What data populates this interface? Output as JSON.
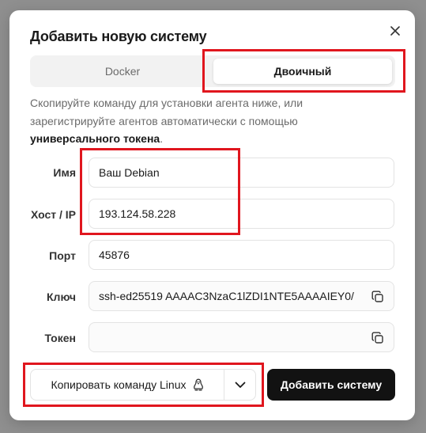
{
  "dialog": {
    "title": "Добавить новую систему",
    "close_icon": "close-icon"
  },
  "tabs": [
    {
      "label": "Docker",
      "active": false
    },
    {
      "label": "Двоичный",
      "active": true
    }
  ],
  "description": {
    "text": "Скопируйте команду для установки агента ниже, или зарегистрируйте агентов автоматически с помощью ",
    "link": "универсального токена",
    "end": "."
  },
  "form": {
    "name": {
      "label": "Имя",
      "value": "Ваш Debian"
    },
    "host": {
      "label": "Хост / IP",
      "value": "193.124.58.228"
    },
    "port": {
      "label": "Порт",
      "value": "45876"
    },
    "key": {
      "label": "Ключ",
      "value": "ssh-ed25519 AAAAC3NzaC1lZDI1NTE5AAAAIEY0/",
      "icon": "copy-icon"
    },
    "token": {
      "label": "Токен",
      "value": "",
      "icon": "copy-icon"
    }
  },
  "footer": {
    "copy_command_label": "Копировать команду Linux",
    "copy_command_icon": "linux-tux-icon",
    "dropdown_icon": "chevron-down-icon",
    "add_system_label": "Добавить систему"
  },
  "colors": {
    "highlight": "#e0161e",
    "primary_button": "#121212",
    "backdrop": "#8f8f8f"
  }
}
